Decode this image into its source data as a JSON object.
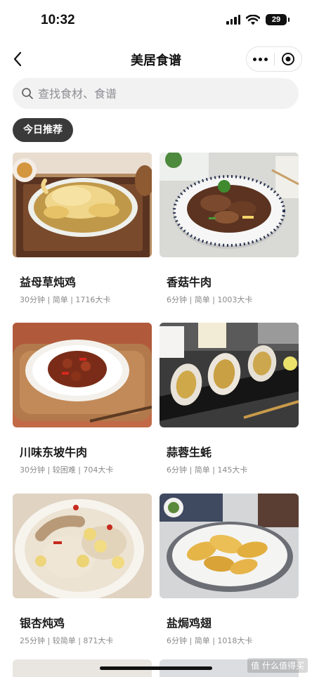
{
  "status_bar": {
    "time": "10:32",
    "battery": "29"
  },
  "nav": {
    "title": "美居食谱"
  },
  "search": {
    "placeholder": "查找食材、食谱"
  },
  "chip": {
    "label": "今日推荐"
  },
  "recipes": [
    {
      "name": "益母草炖鸡",
      "meta": "30分钟 | 简单 | 1716大卡",
      "image": "braised-chicken-photo"
    },
    {
      "name": "香菇牛肉",
      "meta": "6分钟 | 简单 | 1003大卡",
      "image": "mushroom-beef-photo"
    },
    {
      "name": "川味东坡牛肉",
      "meta": "30分钟 | 较困难 | 704大卡",
      "image": "sichuan-beef-photo"
    },
    {
      "name": "蒜蓉生蚝",
      "meta": "6分钟 | 简单 | 145大卡",
      "image": "garlic-oyster-photo"
    },
    {
      "name": "银杏炖鸡",
      "meta": "25分钟 | 较简单 | 871大卡",
      "image": "ginkgo-chicken-photo"
    },
    {
      "name": "盐焗鸡翅",
      "meta": "6分钟 | 简单 | 1018大卡",
      "image": "salt-baked-wings-photo"
    }
  ],
  "watermark": "值 什么值得买",
  "colors": {
    "chip_bg": "#3a3a3a",
    "search_bg": "#f2f2f3",
    "meta_text": "#8a8a8a"
  }
}
